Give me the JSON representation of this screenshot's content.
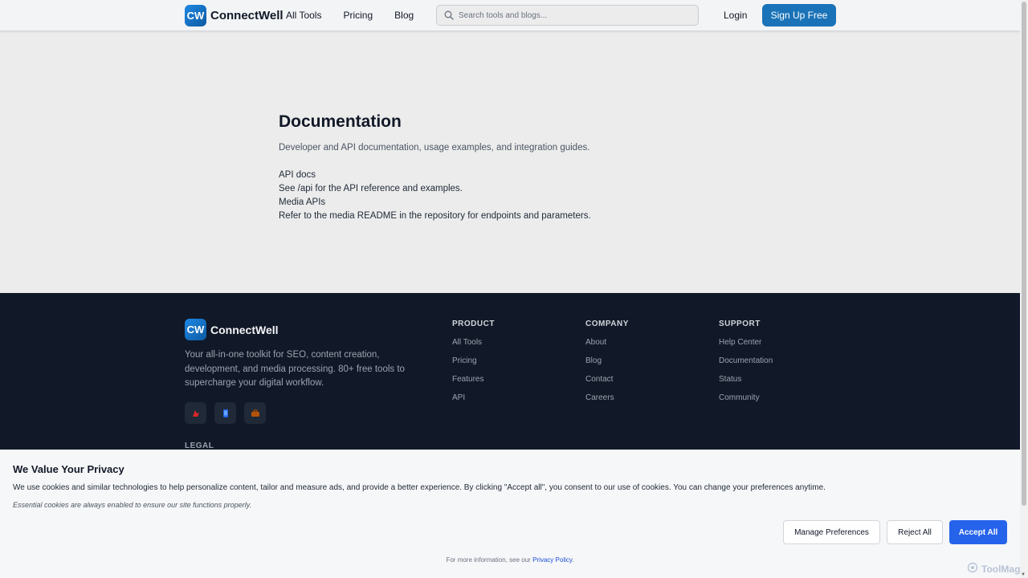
{
  "header": {
    "logo_badge": "CW",
    "logo_text": "ConnectWell",
    "nav": [
      "All Tools",
      "Pricing",
      "Blog"
    ],
    "search_placeholder": "Search tools and blogs...",
    "login": "Login",
    "signup": "Sign Up Free"
  },
  "main": {
    "title": "Documentation",
    "subtitle": "Developer and API documentation, usage examples, and integration guides.",
    "lines": [
      "API docs",
      "See /api for the API reference and examples.",
      "Media APIs",
      "Refer to the media README in the repository for endpoints and parameters."
    ]
  },
  "footer": {
    "logo_badge": "CW",
    "logo_text": "ConnectWell",
    "description": "Your all-in-one toolkit for SEO, content creation, development, and media processing. 80+ free tools to supercharge your digital workflow.",
    "socials": [
      "red-icon",
      "blue-device-icon",
      "briefcase-icon"
    ],
    "columns": [
      {
        "heading": "PRODUCT",
        "links": [
          "All Tools",
          "Pricing",
          "Features",
          "API"
        ]
      },
      {
        "heading": "COMPANY",
        "links": [
          "About",
          "Blog",
          "Contact",
          "Careers"
        ]
      },
      {
        "heading": "SUPPORT",
        "links": [
          "Help Center",
          "Documentation",
          "Status",
          "Community"
        ]
      }
    ],
    "legal_heading": "LEGAL"
  },
  "cookie": {
    "title": "We Value Your Privacy",
    "body": "We use cookies and similar technologies to help personalize content, tailor and measure ads, and provide a better experience. By clicking \"Accept all\", you consent to our use of cookies. You can change your preferences anytime.",
    "note": "Essential cookies are always enabled to ensure our site functions properly.",
    "manage": "Manage Preferences",
    "reject": "Reject All",
    "accept": "Accept All",
    "more_prefix": "For more information, see our",
    "privacy_link": "Privacy Policy",
    "more_suffix": "."
  },
  "watermark": "ToolMage",
  "colors": {
    "brand": "#1a73b8",
    "accept": "#2563eb",
    "footer_bg": "#111827"
  }
}
